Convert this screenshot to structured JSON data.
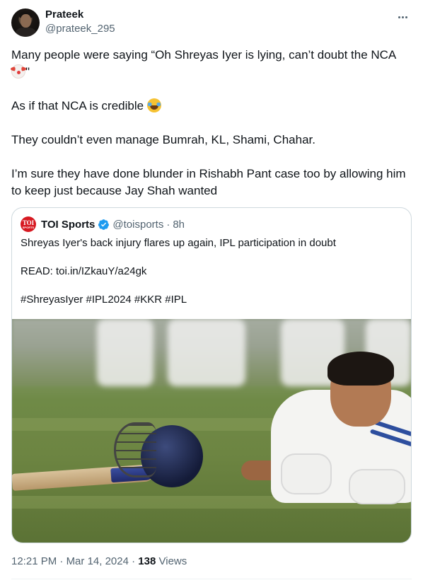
{
  "author": {
    "name": "Prateek",
    "handle": "@prateek_295"
  },
  "tweet": {
    "para1": "Many people were saying “Oh Shreyas Iyer is lying, can’t doubt the NCA",
    "para1_end": "\"",
    "para2": "As if that NCA is credible",
    "para3": "They couldn’t even manage Bumrah, KL, Shami, Chahar.",
    "para4": "I’m sure they have done blunder in Rishabh Pant case too by allowing him to keep just because Jay Shah wanted"
  },
  "quoted": {
    "logo_text": "TOI",
    "logo_sub": "SPORTS",
    "name": "TOI Sports",
    "handle": "@toisports",
    "separator": "·",
    "time": "8h",
    "line1": "Shreyas Iyer's back injury flares up again, IPL participation in doubt",
    "line2": "READ: toi.in/IZkauY/a24gk",
    "line3": "#ShreyasIyer #IPL2024 #KKR #IPL"
  },
  "meta": {
    "time": "12:21 PM",
    "sep1": "·",
    "date": "Mar 14, 2024",
    "sep2": "·",
    "views_count": "138",
    "views_label": "Views"
  },
  "colors": {
    "text": "#0f1419",
    "muted": "#536471",
    "border": "#cfd9de",
    "verified": "#1d9bf0",
    "toi_red": "#d71921"
  },
  "icons": {
    "more": "more-horizontal-icon",
    "verified": "verified-badge-icon",
    "emoji1": "clown-face-emoji",
    "emoji2": "tears-of-joy-emoji"
  }
}
